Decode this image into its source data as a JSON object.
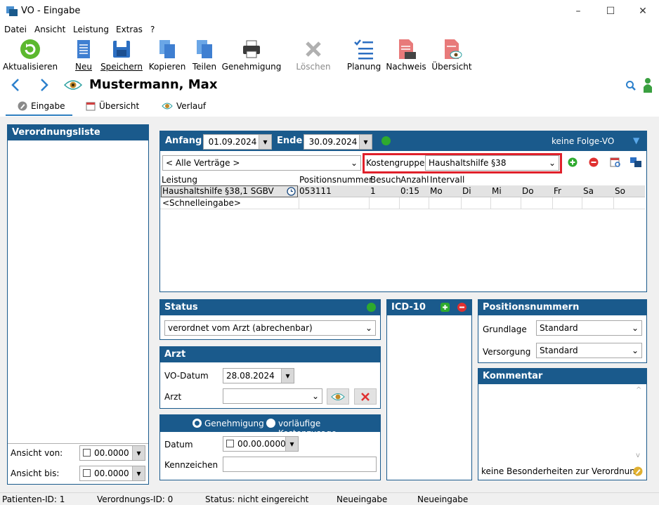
{
  "window": {
    "title": "VO - Eingabe",
    "minimize": "–",
    "maximize": "☐",
    "close": "✕"
  },
  "menu": [
    "Datei",
    "Ansicht",
    "Leistung",
    "Extras",
    "?"
  ],
  "toolbar": {
    "refresh": "Aktualisieren",
    "new": "Neu",
    "save": "Speichern",
    "copy": "Kopieren",
    "split": "Teilen",
    "approval": "Genehmigung",
    "delete": "Löschen",
    "planning": "Planung",
    "proof": "Nachweis",
    "overview": "Übersicht"
  },
  "patient": {
    "name": "Mustermann, Max"
  },
  "tabs": [
    "Eingabe",
    "Übersicht",
    "Verlauf"
  ],
  "left_panel": {
    "title": "Verordnungsliste",
    "view_from_label": "Ansicht von:",
    "view_from_value": "00.0000",
    "view_to_label": "Ansicht bis:",
    "view_to_value": "00.0000"
  },
  "vo_panel": {
    "start_label": "Anfang",
    "start_value": "01.09.2024",
    "end_label": "Ende",
    "end_value": "30.09.2024",
    "followup": "keine Folge-VO",
    "contracts": "< Alle Verträge >",
    "cost_group_label": "Kostengruppe",
    "cost_group_value": "Haushaltshilfe §38",
    "columns": [
      "Leistung",
      "Positionsnummer",
      "Besuch",
      "Anzahl",
      "Intervall"
    ],
    "row": {
      "service": "Haushaltshilfe §38,1 SGBV",
      "position": "053111",
      "visits": "1",
      "amount": "0:15",
      "days": [
        "Mo",
        "Di",
        "Mi",
        "Do",
        "Fr",
        "Sa",
        "So"
      ]
    },
    "quick_entry": "<Schnelleingabe>"
  },
  "status_panel": {
    "title": "Status",
    "value": "verordnet vom Arzt (abrechenbar)",
    "status_color": "#2eaa2e"
  },
  "arzt_panel": {
    "title": "Arzt",
    "vo_date_label": "VO-Datum",
    "vo_date_value": "28.08.2024",
    "doctor_label": "Arzt",
    "doctor_value": ""
  },
  "approval_panel": {
    "option_approval": "Genehmigung",
    "option_provisional": "vorläufige Kostenzusage",
    "date_label": "Datum",
    "date_value": "00.00.0000",
    "ref_label": "Kennzeichen",
    "ref_value": ""
  },
  "icd_panel": {
    "title": "ICD-10"
  },
  "position_panel": {
    "title": "Positionsnummern",
    "basis_label": "Grundlage",
    "basis_value": "Standard",
    "care_label": "Versorgung",
    "care_value": "Standard"
  },
  "comment_panel": {
    "title": "Kommentar",
    "footer": "keine Besonderheiten zur Verordnung"
  },
  "statusbar": {
    "patient_id": "Patienten-ID: 1",
    "order_id": "Verordnungs-ID: 0",
    "status": "Status: nicht eingereicht",
    "mode1": "Neueingabe",
    "mode2": "Neueingabe"
  },
  "colors": {
    "accent": "#1a5a8c",
    "highlight": "#e0202a",
    "green": "#2eaa2e",
    "red": "#e03030"
  }
}
